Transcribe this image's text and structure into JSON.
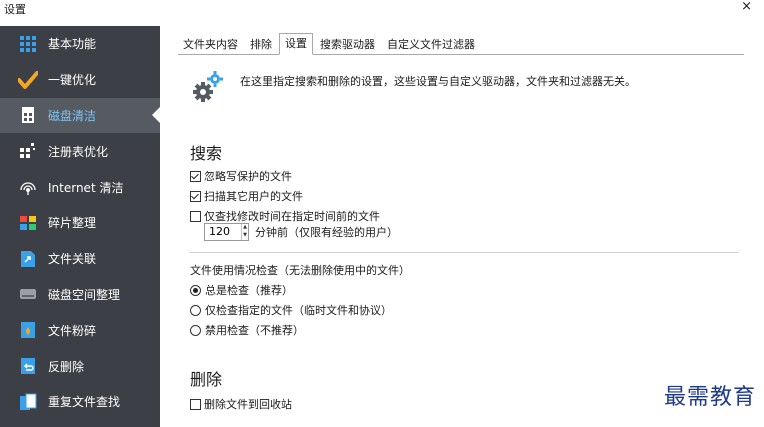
{
  "window": {
    "title": "设置",
    "close_glyph": "×"
  },
  "sidebar": {
    "items": [
      {
        "label": "基本功能",
        "icon": "grid-icon",
        "color": "#3aa0e8"
      },
      {
        "label": "一键优化",
        "icon": "checkmark-icon",
        "color": "#f5a623"
      },
      {
        "label": "磁盘清洁",
        "icon": "disk-clean-icon",
        "color": "#ffffff",
        "active": true
      },
      {
        "label": "注册表优化",
        "icon": "registry-icon",
        "color": "#ffffff"
      },
      {
        "label": "Internet 清洁",
        "icon": "globe-icon",
        "color": "#ffffff"
      },
      {
        "label": "碎片整理",
        "icon": "defrag-icon",
        "color": "#e84c3d"
      },
      {
        "label": "文件关联",
        "icon": "file-link-icon",
        "color": "#3aa0e8"
      },
      {
        "label": "磁盘空间整理",
        "icon": "disk-space-icon",
        "color": "#9aa0a6"
      },
      {
        "label": "文件粉碎",
        "icon": "file-shred-icon",
        "color": "#3aa0e8"
      },
      {
        "label": "反删除",
        "icon": "undelete-icon",
        "color": "#3aa0e8"
      },
      {
        "label": "重复文件查找",
        "icon": "duplicate-files-icon",
        "color": "#3aa0e8"
      }
    ]
  },
  "tabs": [
    {
      "label": "文件夹内容"
    },
    {
      "label": "排除"
    },
    {
      "label": "设置",
      "active": true
    },
    {
      "label": "搜索驱动器"
    },
    {
      "label": "自定义文件过滤器"
    }
  ],
  "info": {
    "text": "在这里指定搜索和删除的设置，这些设置与自定义驱动器，文件夹和过滤器无关。"
  },
  "search": {
    "title": "搜索",
    "ignore_protected": {
      "label": "忽略写保护的文件",
      "checked": true
    },
    "scan_other_users": {
      "label": "扫描其它用户的文件",
      "checked": true
    },
    "only_modified": {
      "label": "仅查找修改时间在指定时间前的文件",
      "checked": false
    },
    "minutes_value": "120",
    "minutes_label": "分钟前（仅限有经验的用户）"
  },
  "usage_check": {
    "title": "文件使用情况检查（无法删除使用中的文件）",
    "options": [
      {
        "label": "总是检查（推荐）",
        "checked": true
      },
      {
        "label": "仅检查指定的文件（临时文件和协议）",
        "checked": false
      },
      {
        "label": "禁用检查（不推荐）",
        "checked": false
      }
    ]
  },
  "delete": {
    "title": "删除",
    "to_recycle_bin": {
      "label": "删除文件到回收站",
      "checked": false
    }
  },
  "watermark": "最需教育"
}
